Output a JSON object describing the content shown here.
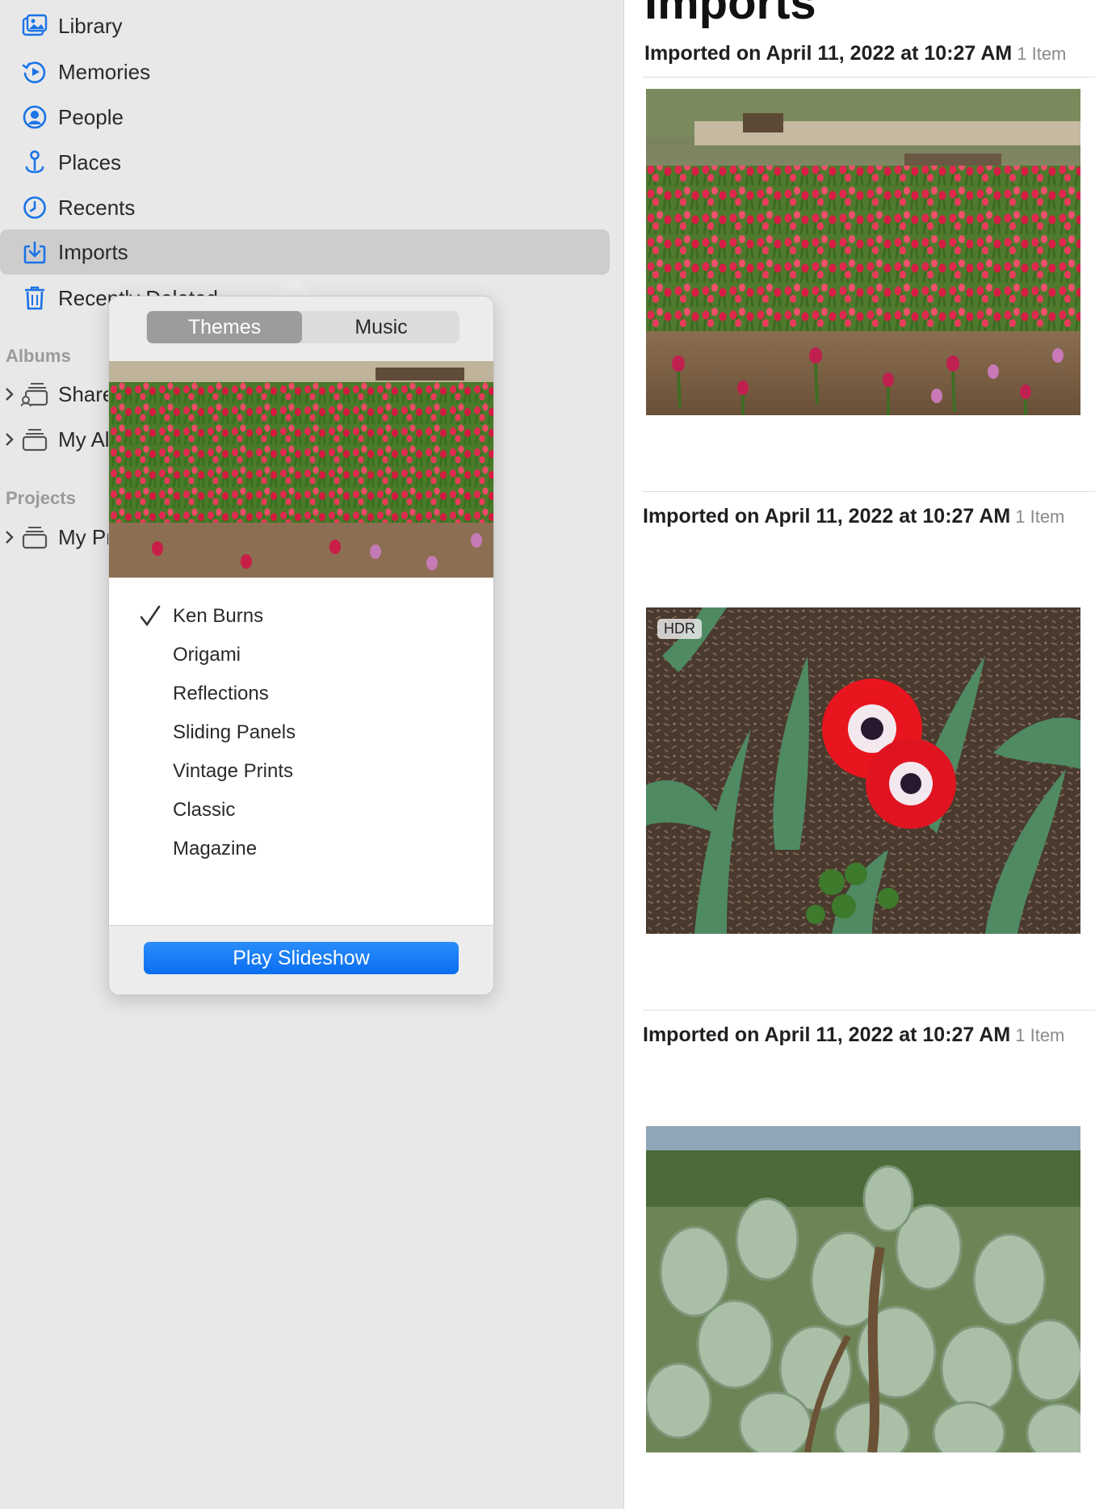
{
  "sidebar": {
    "items": [
      {
        "label": "Library",
        "icon": "library-icon"
      },
      {
        "label": "Memories",
        "icon": "memories-icon"
      },
      {
        "label": "People",
        "icon": "people-icon"
      },
      {
        "label": "Places",
        "icon": "places-icon"
      },
      {
        "label": "Recents",
        "icon": "recents-icon"
      },
      {
        "label": "Imports",
        "icon": "imports-icon",
        "selected": true
      },
      {
        "label": "Recently Deleted",
        "icon": "trash-icon"
      }
    ],
    "albums_title": "Albums",
    "albums": [
      {
        "label": "Shared Albums",
        "icon": "shared-albums-icon"
      },
      {
        "label": "My Albums",
        "icon": "albums-stack-icon"
      }
    ],
    "projects_title": "Projects",
    "projects": [
      {
        "label": "My Projects",
        "icon": "projects-stack-icon"
      }
    ],
    "accent_color": "#1a73e8"
  },
  "main": {
    "title": "Imports",
    "groups": [
      {
        "title": "Imported on April 11, 2022 at 10:27 AM",
        "count": "1 Item",
        "photo": "tulip-garden-photo"
      },
      {
        "title": "Imported on April 11, 2022 at 10:27 AM",
        "count": "1 Item",
        "photo": "red-anemone-photo",
        "badge": "HDR"
      },
      {
        "title": "Imported on April 11, 2022 at 10:27 AM",
        "count": "1 Item",
        "photo": "prickly-pear-cactus-photo"
      }
    ]
  },
  "popover": {
    "tabs": [
      {
        "label": "Themes",
        "active": true
      },
      {
        "label": "Music",
        "active": false
      }
    ],
    "themes": [
      {
        "label": "Ken Burns",
        "checked": true
      },
      {
        "label": "Origami",
        "checked": false
      },
      {
        "label": "Reflections",
        "checked": false
      },
      {
        "label": "Sliding Panels",
        "checked": false
      },
      {
        "label": "Vintage Prints",
        "checked": false
      },
      {
        "label": "Classic",
        "checked": false
      },
      {
        "label": "Magazine",
        "checked": false
      }
    ],
    "play_label": "Play Slideshow",
    "play_color": "#1a7cf5"
  }
}
